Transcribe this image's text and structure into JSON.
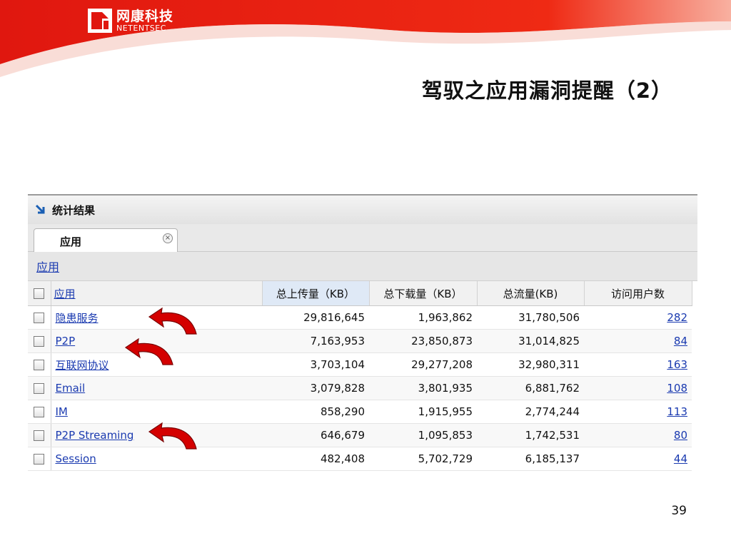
{
  "brand": {
    "name_cn": "网康科技",
    "name_en": "NETENTSEC",
    "primary_color": "#e21a1a"
  },
  "slide": {
    "title": "驾驭之应用漏洞提醒（2）",
    "page_number": "39"
  },
  "panel": {
    "title": "统计结果",
    "tab_label": "应用",
    "tab_close_icon": "close-icon",
    "breadcrumb": "应用"
  },
  "table": {
    "headers": [
      "应用",
      "总上传量（KB）",
      "总下载量（KB）",
      "总流量(KB)",
      "访问用户数"
    ],
    "rows": [
      {
        "app": "隐患服务",
        "upload": "29,816,645",
        "download": "1,963,862",
        "total": "31,780,506",
        "users": "282"
      },
      {
        "app": "P2P",
        "upload": "7,163,953",
        "download": "23,850,873",
        "total": "31,014,825",
        "users": "84"
      },
      {
        "app": "互联网协议",
        "upload": "3,703,104",
        "download": "29,277,208",
        "total": "32,980,311",
        "users": "163"
      },
      {
        "app": "Email",
        "upload": "3,079,828",
        "download": "3,801,935",
        "total": "6,881,762",
        "users": "108"
      },
      {
        "app": "IM",
        "upload": "858,290",
        "download": "1,915,955",
        "total": "2,774,244",
        "users": "113"
      },
      {
        "app": "P2P Streaming",
        "upload": "646,679",
        "download": "1,095,853",
        "total": "1,742,531",
        "users": "80"
      },
      {
        "app": "Session",
        "upload": "482,408",
        "download": "5,702,729",
        "total": "6,185,137",
        "users": "44"
      }
    ]
  },
  "annotation": {
    "arrow_color": "#d40000"
  }
}
